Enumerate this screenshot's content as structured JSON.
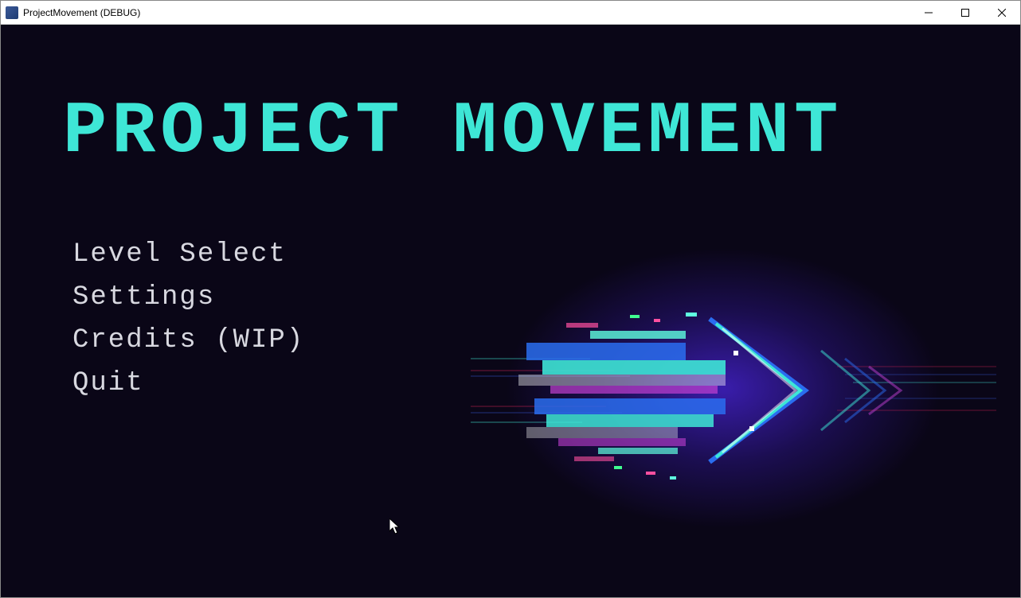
{
  "window": {
    "title": "ProjectMovement (DEBUG)"
  },
  "game": {
    "title": "PROJECT MOVEMENT"
  },
  "menu": {
    "items": [
      {
        "label": "Level Select"
      },
      {
        "label": "Settings"
      },
      {
        "label": "Credits (WIP)"
      },
      {
        "label": "Quit"
      }
    ]
  },
  "colors": {
    "background": "#0a0617",
    "title": "#3ee6d6",
    "menu_text": "#d8d8e0"
  }
}
